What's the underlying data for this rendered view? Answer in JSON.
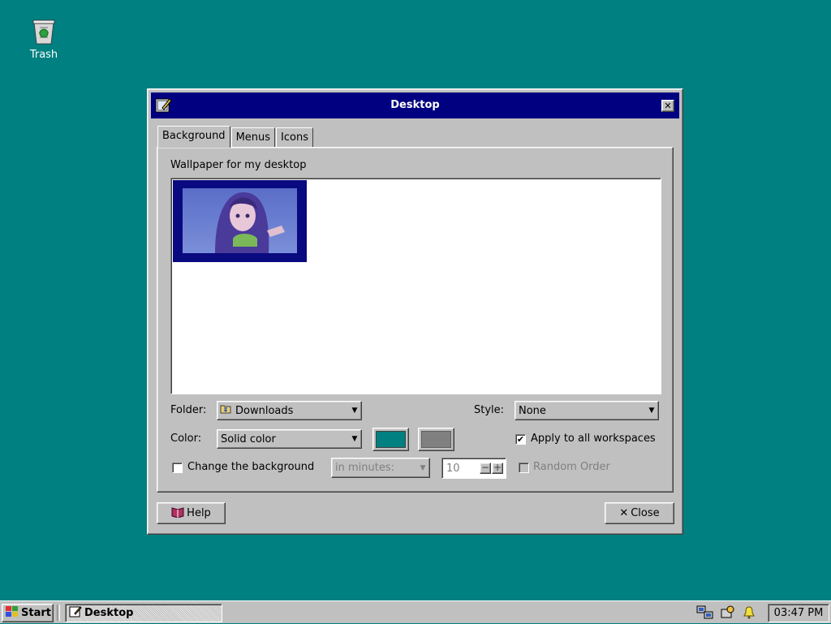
{
  "desktop": {
    "icons": [
      {
        "label": "Trash",
        "icon": "trash-icon"
      }
    ],
    "background_color": "#008080"
  },
  "window": {
    "title": "Desktop",
    "close_glyph": "✕",
    "titlebar_color": "#000080",
    "tabs": [
      {
        "label": "Background",
        "active": true
      },
      {
        "label": "Menus",
        "active": false
      },
      {
        "label": "Icons",
        "active": false
      }
    ],
    "background_tab": {
      "wallpaper_label": "Wallpaper for my desktop",
      "folder_label": "Folder:",
      "folder_value": "Downloads",
      "style_label": "Style:",
      "style_value": "None",
      "color_label": "Color:",
      "color_value": "Solid color",
      "primary_color": "#008080",
      "secondary_color": "#808080",
      "apply_all_label": "Apply to all workspaces",
      "apply_all_checked": true,
      "change_bg_label": "Change the background",
      "change_bg_checked": false,
      "interval_value": "in minutes:",
      "interval_amount": "10",
      "random_order_label": "Random Order",
      "random_order_checked": false
    },
    "buttons": {
      "help_label": "Help",
      "close_label": "Close"
    }
  },
  "taskbar": {
    "start_label": "Start",
    "task_label": "Desktop",
    "clock": "03:47 PM",
    "tray_icons": [
      "network-icon",
      "settings-icon",
      "notification-bell-icon"
    ]
  }
}
